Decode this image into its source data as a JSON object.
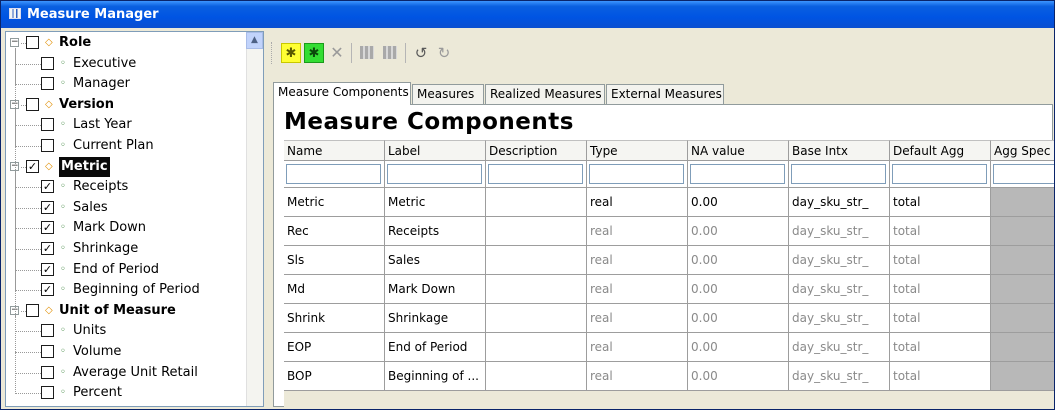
{
  "window": {
    "title": "Measure Manager"
  },
  "tree": [
    {
      "label": "Role",
      "level": 0,
      "checked": false,
      "expanded": true
    },
    {
      "label": "Executive",
      "level": 1,
      "checked": false
    },
    {
      "label": "Manager",
      "level": 1,
      "checked": false
    },
    {
      "label": "Version",
      "level": 0,
      "checked": false,
      "expanded": true
    },
    {
      "label": "Last Year",
      "level": 1,
      "checked": false
    },
    {
      "label": "Current Plan",
      "level": 1,
      "checked": false
    },
    {
      "label": "Metric",
      "level": 0,
      "checked": true,
      "expanded": true,
      "selected": true
    },
    {
      "label": "Receipts",
      "level": 1,
      "checked": true
    },
    {
      "label": "Sales",
      "level": 1,
      "checked": true
    },
    {
      "label": "Mark Down",
      "level": 1,
      "checked": true
    },
    {
      "label": "Shrinkage",
      "level": 1,
      "checked": true
    },
    {
      "label": "End of Period",
      "level": 1,
      "checked": true
    },
    {
      "label": "Beginning of Period",
      "level": 1,
      "checked": true
    },
    {
      "label": "Unit of Measure",
      "level": 0,
      "checked": false,
      "expanded": true
    },
    {
      "label": "Units",
      "level": 1,
      "checked": false
    },
    {
      "label": "Volume",
      "level": 1,
      "checked": false
    },
    {
      "label": "Average Unit Retail",
      "level": 1,
      "checked": false
    },
    {
      "label": "Percent",
      "level": 1,
      "checked": false
    }
  ],
  "toolbar": {
    "buttons": [
      "add-yellow-icon",
      "add-green-icon",
      "delete-icon",
      "grid-icon",
      "grid-alt-icon",
      "undo-icon",
      "redo-icon"
    ]
  },
  "tabs": [
    {
      "label": "Measure Components",
      "active": true
    },
    {
      "label": "Measures",
      "active": false
    },
    {
      "label": "Realized Measures",
      "active": false
    },
    {
      "label": "External Measures",
      "active": false
    }
  ],
  "page_title": "Measure Components",
  "table": {
    "columns": [
      "Name",
      "Label",
      "Description",
      "Type",
      "NA value",
      "Base Intx",
      "Default Agg",
      "Agg Spec"
    ],
    "rows": [
      [
        "Metric",
        "Metric",
        "",
        "real",
        "0.00",
        "day_sku_str_",
        "total",
        ""
      ],
      [
        "Rec",
        "Receipts",
        "",
        "real",
        "0.00",
        "day_sku_str_",
        "total",
        ""
      ],
      [
        "Sls",
        "Sales",
        "",
        "real",
        "0.00",
        "day_sku_str_",
        "total",
        ""
      ],
      [
        "Md",
        "Mark Down",
        "",
        "real",
        "0.00",
        "day_sku_str_",
        "total",
        ""
      ],
      [
        "Shrink",
        "Shrinkage",
        "",
        "real",
        "0.00",
        "day_sku_str_",
        "total",
        ""
      ],
      [
        "EOP",
        "End of Period",
        "",
        "real",
        "0.00",
        "day_sku_str_",
        "total",
        ""
      ],
      [
        "BOP",
        "Beginning of ...",
        "",
        "real",
        "0.00",
        "day_sku_str_",
        "total",
        ""
      ]
    ]
  }
}
